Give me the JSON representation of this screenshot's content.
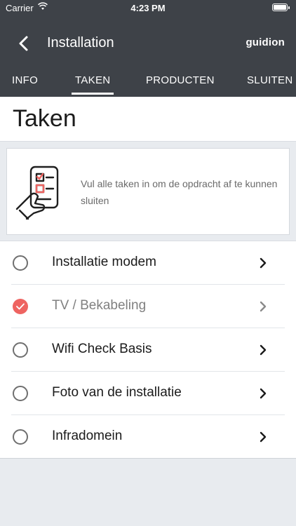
{
  "status_bar": {
    "carrier": "Carrier",
    "time": "4:23 PM"
  },
  "header": {
    "title": "Installation",
    "brand": "guidion"
  },
  "tabs": [
    {
      "label": "INFO",
      "active": false
    },
    {
      "label": "TAKEN",
      "active": true
    },
    {
      "label": "PRODUCTEN",
      "active": false
    },
    {
      "label": "SLUITEN",
      "active": false
    }
  ],
  "page": {
    "title": "Taken"
  },
  "info_card": {
    "icon": "phone-checklist-icon",
    "message": "Vul alle taken in om de opdracht af te kunnen sluiten"
  },
  "tasks": [
    {
      "label": "Installatie modem",
      "completed": false
    },
    {
      "label": "TV / Bekabeling",
      "completed": true
    },
    {
      "label": "Wifi Check Basis",
      "completed": false
    },
    {
      "label": "Foto van de installatie",
      "completed": false
    },
    {
      "label": "Infradomein",
      "completed": false
    }
  ],
  "colors": {
    "header": "#3e4248",
    "accent": "#ee6461",
    "background": "#e8ebef"
  }
}
